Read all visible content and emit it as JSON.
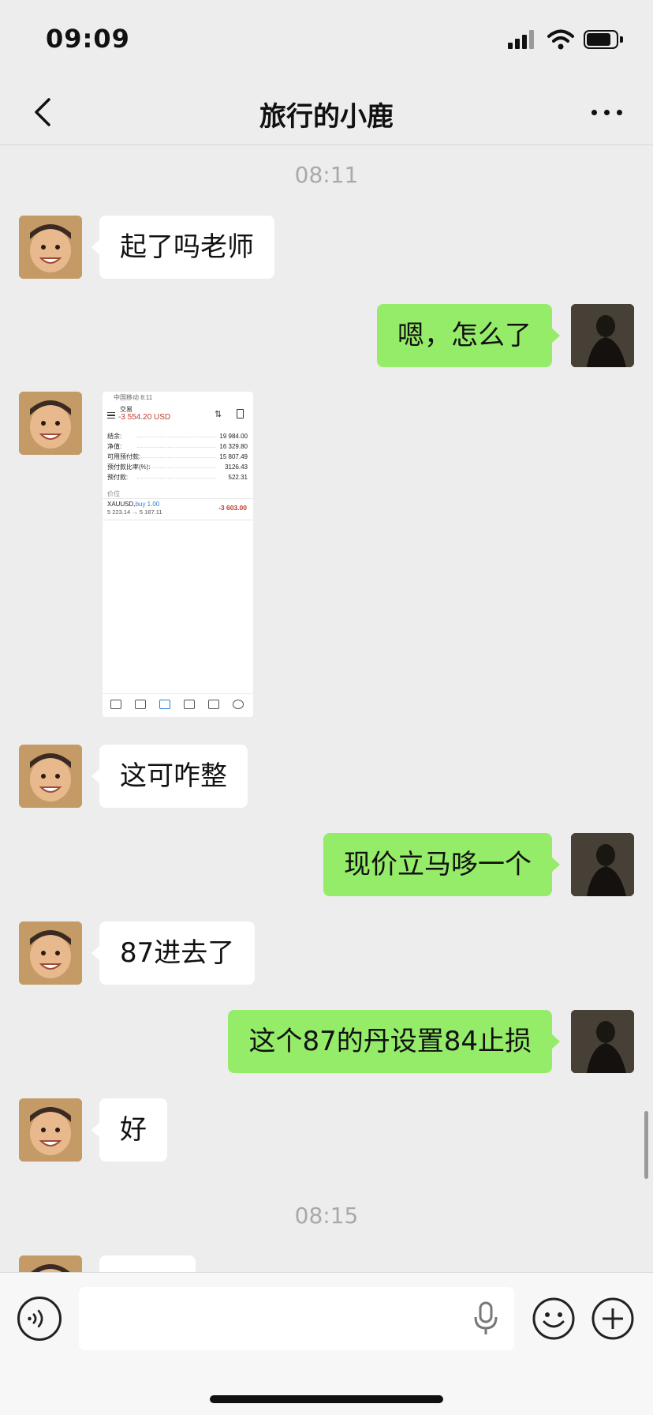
{
  "status_bar": {
    "time": "09:09"
  },
  "header": {
    "title": "旅行的小鹿",
    "back_icon": "chevron-left-icon",
    "more_icon": "more-dots-icon"
  },
  "messages": {
    "timestamp_1": "08:11",
    "m1": "起了吗老师",
    "m2": "嗯，怎么了",
    "m4": "这可咋整",
    "m5": "现价立马哆一个",
    "m6": "87进去了",
    "m7": "这个87的丹设置84止损",
    "m8": "好",
    "timestamp_2": "08:15"
  },
  "image_message": {
    "status_time": "中国移动 8:11",
    "title": "交易",
    "balance": "-3 554.20 USD",
    "rows": [
      {
        "label": "结余:",
        "value": "19 984.00"
      },
      {
        "label": "净值:",
        "value": "16 329.80"
      },
      {
        "label": "可用预付款:",
        "value": "15 807.49"
      },
      {
        "label": "预付款比率(%):",
        "value": "3126.43"
      },
      {
        "label": "预付款:",
        "value": "522.31"
      }
    ],
    "section": "价位",
    "position_symbol": "XAUUSD,",
    "position_side": "buy 1.00",
    "position_prices": "5 223.14 → 5 187.11",
    "position_pl": "-3 603.00"
  },
  "input_bar": {
    "placeholder": "",
    "icons": [
      "voice-icon",
      "microphone-icon",
      "emoji-icon",
      "plus-icon"
    ]
  },
  "colors": {
    "background": "#ededed",
    "incoming_bubble": "#ffffff",
    "outgoing_bubble": "#95ec69",
    "timestamp": "#a9a9a9"
  }
}
